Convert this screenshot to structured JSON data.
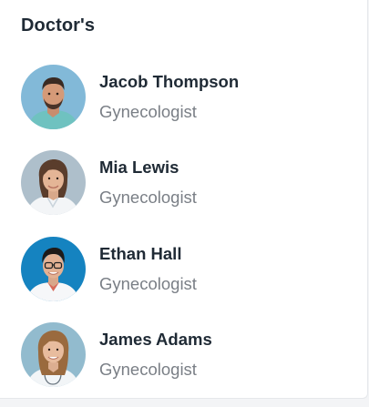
{
  "panel": {
    "title": "Doctor's"
  },
  "doctors": [
    {
      "name": "Jacob Thompson",
      "specialty": "Gynecologist",
      "avatar_icon": "doctor-photo-avatar",
      "bg": "#7fb6d6"
    },
    {
      "name": "Mia Lewis",
      "specialty": "Gynecologist",
      "avatar_icon": "doctor-photo-avatar",
      "bg": "#a9bcc9"
    },
    {
      "name": "Ethan Hall",
      "specialty": "Gynecologist",
      "avatar_icon": "doctor-photo-avatar",
      "bg": "#1a7fb7"
    },
    {
      "name": "James Adams",
      "specialty": "Gynecologist",
      "avatar_icon": "doctor-photo-avatar",
      "bg": "#8fb8cc"
    }
  ]
}
